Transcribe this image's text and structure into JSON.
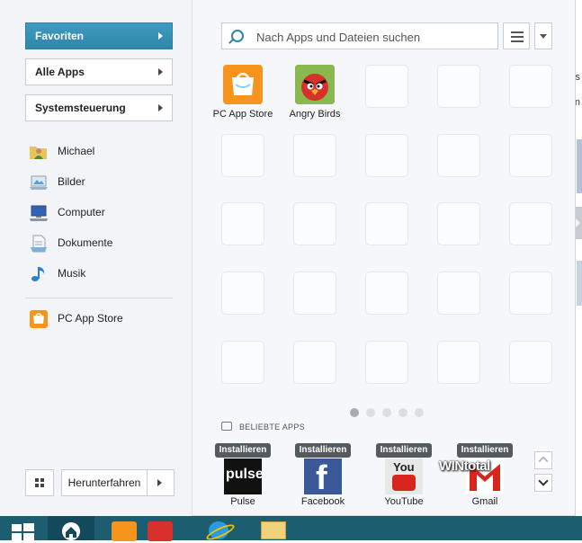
{
  "menu": {
    "nav": [
      {
        "label": "Favoriten",
        "active": true
      },
      {
        "label": "Alle Apps",
        "active": false
      },
      {
        "label": "Systemsteuerung",
        "active": false
      }
    ],
    "places": [
      {
        "label": "Michael",
        "icon": "user-folder-icon"
      },
      {
        "label": "Bilder",
        "icon": "pictures-icon"
      },
      {
        "label": "Computer",
        "icon": "computer-icon"
      },
      {
        "label": "Dokumente",
        "icon": "documents-icon"
      },
      {
        "label": "Musik",
        "icon": "music-icon"
      }
    ],
    "pinned": [
      {
        "label": "PC App Store",
        "icon": "pc-app-store-icon"
      }
    ],
    "shutdown_label": "Herunterfahren"
  },
  "search": {
    "placeholder": "Nach Apps und Dateien suchen"
  },
  "favorites": [
    {
      "label": "PC App Store",
      "icon": "pc-app-store-icon"
    },
    {
      "label": "Angry Birds",
      "icon": "angry-birds-icon"
    }
  ],
  "page_indicator": {
    "count": 5,
    "active": 1
  },
  "popular": {
    "header": "BELIEBTE APPS",
    "install_label": "Installieren",
    "apps": [
      {
        "label": "Pulse",
        "icon": "pulse-icon",
        "icon_text": "pulse"
      },
      {
        "label": "Facebook",
        "icon": "facebook-icon",
        "icon_text": "f"
      },
      {
        "label": "YouTube",
        "icon": "youtube-icon",
        "icon_text": "You"
      },
      {
        "label": "Gmail",
        "icon": "gmail-icon",
        "icon_text": "M"
      }
    ]
  },
  "background": {
    "side_letters": [
      "is",
      "n"
    ]
  },
  "watermark": "WINtotal",
  "colors": {
    "accent": "#2f86a9",
    "taskbar": "#1c5d70",
    "install_button": "#555a60"
  }
}
